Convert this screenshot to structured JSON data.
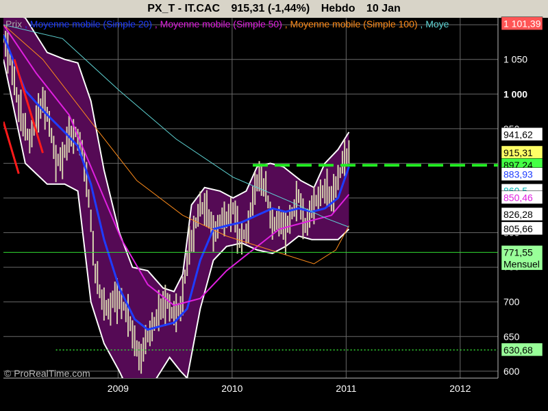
{
  "header": {
    "symbol": "PX_T - IT.CAC",
    "last": "915,31 (-1,44%)",
    "period": "Hebdo",
    "date": "10 Jan"
  },
  "legend": {
    "price": "Prix",
    "ma20": "Moyenne mobile (Simple 20)",
    "ma50": "Moyenne mobile (Simple 50)",
    "ma100": "Moyenne mobile (Simple 100)",
    "ma200": "Moye"
  },
  "watermark": "© ProRealTime.com",
  "colors": {
    "background": "#000000",
    "header": "#d8d4c8",
    "bollinger_fill": "#550a55",
    "bollinger_edge": "#ffffff",
    "candle": "#d8d4b0",
    "ma20": "#1e3cff",
    "ma50": "#e020e0",
    "ma100": "#ff8c1a",
    "ma200": "#5fd6d6",
    "resistance": "#22ee22",
    "support_line": "#33dd33",
    "trend": "#ff1a1a"
  },
  "chart_data": {
    "type": "line",
    "x_axis": {
      "ticks": [
        "2009",
        "2010",
        "2011",
        "2012"
      ]
    },
    "y_axis": {
      "range": [
        590,
        1110
      ],
      "ticks": [
        600,
        650,
        700,
        750,
        800,
        850,
        900,
        950,
        1000,
        1050,
        1100
      ],
      "tick_labels": [
        "600",
        "650",
        "700",
        "750",
        "800",
        "850",
        "900",
        "950",
        "1 000",
        "1 050",
        "1 100"
      ],
      "bold_ticks": [
        1000
      ]
    },
    "grid": true,
    "price_series": [
      [
        "2007-12-31",
        1080
      ],
      [
        "2008-01-21",
        1050
      ],
      [
        "2008-02-11",
        1000
      ],
      [
        "2008-03-03",
        955
      ],
      [
        "2008-03-24",
        935
      ],
      [
        "2008-04-14",
        960
      ],
      [
        "2008-05-05",
        990
      ],
      [
        "2008-05-26",
        960
      ],
      [
        "2008-06-16",
        900
      ],
      [
        "2008-07-07",
        910
      ],
      [
        "2008-07-28",
        935
      ],
      [
        "2008-08-18",
        945
      ],
      [
        "2008-09-08",
        920
      ],
      [
        "2008-09-29",
        850
      ],
      [
        "2008-10-20",
        745
      ],
      [
        "2008-11-10",
        700
      ],
      [
        "2008-12-01",
        690
      ],
      [
        "2008-12-22",
        705
      ],
      [
        "2009-01-12",
        700
      ],
      [
        "2009-02-02",
        680
      ],
      [
        "2009-02-23",
        640
      ],
      [
        "2009-03-16",
        620
      ],
      [
        "2009-04-06",
        650
      ],
      [
        "2009-04-27",
        670
      ],
      [
        "2009-05-18",
        690
      ],
      [
        "2009-06-08",
        700
      ],
      [
        "2009-06-29",
        680
      ],
      [
        "2009-07-20",
        690
      ],
      [
        "2009-08-10",
        760
      ],
      [
        "2009-08-31",
        800
      ],
      [
        "2009-09-21",
        840
      ],
      [
        "2009-10-12",
        830
      ],
      [
        "2009-11-02",
        800
      ],
      [
        "2009-11-23",
        815
      ],
      [
        "2009-12-14",
        820
      ],
      [
        "2010-01-04",
        835
      ],
      [
        "2010-01-25",
        790
      ],
      [
        "2010-02-15",
        800
      ],
      [
        "2010-03-08",
        845
      ],
      [
        "2010-03-29",
        885
      ],
      [
        "2010-04-19",
        860
      ],
      [
        "2010-05-10",
        810
      ],
      [
        "2010-05-31",
        820
      ],
      [
        "2010-06-21",
        800
      ],
      [
        "2010-07-12",
        830
      ],
      [
        "2010-08-02",
        850
      ],
      [
        "2010-08-23",
        810
      ],
      [
        "2010-09-13",
        835
      ],
      [
        "2010-10-04",
        850
      ],
      [
        "2010-10-25",
        865
      ],
      [
        "2010-11-15",
        845
      ],
      [
        "2010-12-06",
        880
      ],
      [
        "2010-12-27",
        905
      ],
      [
        "2011-01-10",
        915
      ]
    ],
    "moving_averages": [
      {
        "name": "Moyenne mobile (Simple 20)",
        "color": "#1e3cff",
        "points": [
          [
            "2007-12-31",
            1085
          ],
          [
            "2008-03-10",
            1005
          ],
          [
            "2008-05-19",
            970
          ],
          [
            "2008-07-14",
            945
          ],
          [
            "2008-08-25",
            925
          ],
          [
            "2008-10-06",
            870
          ],
          [
            "2008-11-17",
            790
          ],
          [
            "2009-01-05",
            720
          ],
          [
            "2009-02-23",
            675
          ],
          [
            "2009-04-06",
            660
          ],
          [
            "2009-05-18",
            665
          ],
          [
            "2009-06-29",
            670
          ],
          [
            "2009-08-10",
            690
          ],
          [
            "2009-09-21",
            760
          ],
          [
            "2009-11-02",
            805
          ],
          [
            "2009-12-14",
            810
          ],
          [
            "2010-02-01",
            815
          ],
          [
            "2010-03-22",
            825
          ],
          [
            "2010-05-10",
            835
          ],
          [
            "2010-06-21",
            830
          ],
          [
            "2010-08-02",
            835
          ],
          [
            "2010-09-13",
            830
          ],
          [
            "2010-10-25",
            835
          ],
          [
            "2010-12-06",
            850
          ],
          [
            "2011-01-10",
            895
          ]
        ]
      },
      {
        "name": "Moyenne mobile (Simple 50)",
        "color": "#e020e0",
        "points": [
          [
            "2007-12-31",
            1100
          ],
          [
            "2008-04-14",
            1030
          ],
          [
            "2008-07-28",
            970
          ],
          [
            "2008-10-20",
            880
          ],
          [
            "2009-01-12",
            790
          ],
          [
            "2009-04-06",
            725
          ],
          [
            "2009-06-29",
            695
          ],
          [
            "2009-09-21",
            705
          ],
          [
            "2009-12-14",
            745
          ],
          [
            "2010-03-08",
            775
          ],
          [
            "2010-06-01",
            805
          ],
          [
            "2010-08-23",
            815
          ],
          [
            "2010-11-15",
            825
          ],
          [
            "2011-01-10",
            855
          ]
        ]
      },
      {
        "name": "Moyenne mobile (Simple 100)",
        "color": "#ff8c1a",
        "points": [
          [
            "2007-12-31",
            1100
          ],
          [
            "2008-05-05",
            1050
          ],
          [
            "2008-10-06",
            960
          ],
          [
            "2009-03-02",
            875
          ],
          [
            "2009-07-27",
            825
          ],
          [
            "2009-12-14",
            795
          ],
          [
            "2010-05-03",
            775
          ],
          [
            "2010-09-20",
            755
          ],
          [
            "2010-11-29",
            775
          ],
          [
            "2011-01-10",
            810
          ]
        ]
      },
      {
        "name": "Moye",
        "color": "#5fd6d6",
        "points": [
          [
            "2007-12-31",
            1100
          ],
          [
            "2008-07-07",
            1080
          ],
          [
            "2009-01-05",
            1005
          ],
          [
            "2009-07-06",
            935
          ],
          [
            "2010-01-04",
            880
          ],
          [
            "2010-07-05",
            845
          ],
          [
            "2010-11-01",
            820
          ],
          [
            "2011-01-10",
            808
          ]
        ]
      }
    ],
    "bollinger_bands": {
      "upper": [
        [
          "2007-12-31",
          1120
        ],
        [
          "2008-03-10",
          1110
        ],
        [
          "2008-05-19",
          1060
        ],
        [
          "2008-07-14",
          1050
        ],
        [
          "2008-08-25",
          1045
        ],
        [
          "2008-10-06",
          990
        ],
        [
          "2008-11-17",
          890
        ],
        [
          "2009-01-05",
          800
        ],
        [
          "2009-02-16",
          750
        ],
        [
          "2009-04-06",
          745
        ],
        [
          "2009-05-25",
          720
        ],
        [
          "2009-06-29",
          715
        ],
        [
          "2009-07-27",
          740
        ],
        [
          "2009-08-24",
          840
        ],
        [
          "2009-10-05",
          865
        ],
        [
          "2009-11-23",
          860
        ],
        [
          "2010-01-04",
          850
        ],
        [
          "2010-02-15",
          860
        ],
        [
          "2010-03-22",
          895
        ],
        [
          "2010-05-03",
          900
        ],
        [
          "2010-06-14",
          895
        ],
        [
          "2010-08-09",
          875
        ],
        [
          "2010-09-20",
          865
        ],
        [
          "2010-10-25",
          900
        ],
        [
          "2010-12-06",
          920
        ],
        [
          "2011-01-10",
          945
        ]
      ],
      "lower": [
        [
          "2007-12-31",
          1050
        ],
        [
          "2008-03-10",
          900
        ],
        [
          "2008-05-19",
          870
        ],
        [
          "2008-07-14",
          870
        ],
        [
          "2008-08-25",
          860
        ],
        [
          "2008-10-06",
          700
        ],
        [
          "2008-11-17",
          640
        ],
        [
          "2009-01-05",
          600
        ],
        [
          "2009-02-16",
          560
        ],
        [
          "2009-04-06",
          570
        ],
        [
          "2009-05-18",
          600
        ],
        [
          "2009-06-15",
          620
        ],
        [
          "2009-07-20",
          600
        ],
        [
          "2009-08-10",
          590
        ],
        [
          "2009-09-21",
          690
        ],
        [
          "2009-11-02",
          760
        ],
        [
          "2009-12-14",
          780
        ],
        [
          "2010-02-01",
          785
        ],
        [
          "2010-03-22",
          775
        ],
        [
          "2010-05-10",
          770
        ],
        [
          "2010-06-21",
          780
        ],
        [
          "2010-08-02",
          795
        ],
        [
          "2010-09-13",
          790
        ],
        [
          "2010-10-25",
          790
        ],
        [
          "2010-12-06",
          790
        ],
        [
          "2011-01-10",
          805
        ]
      ]
    },
    "horizontal_levels": [
      {
        "value": 897.24,
        "style": "dashed",
        "color": "#22ee22",
        "start": "2010-03-08"
      },
      {
        "value": 771.55,
        "style": "solid",
        "color": "#33dd33",
        "start": "2007-12-31"
      },
      {
        "value": 630.68,
        "style": "dotted",
        "color": "#33dd33",
        "start": "2008-06-16"
      }
    ],
    "trend_lines": [
      {
        "color": "#ff1a1a",
        "points": [
          [
            "2007-12-31",
            960
          ],
          [
            "2008-02-18",
            885
          ]
        ]
      },
      {
        "color": "#ff1a1a",
        "points": [
          [
            "2008-02-04",
            1050
          ],
          [
            "2008-05-05",
            915
          ]
        ]
      }
    ],
    "price_labels": [
      {
        "text": "1 101,39",
        "value": 1101.39,
        "bg": "#ff5555",
        "fg": "#ffffff"
      },
      {
        "text": "941,62",
        "value": 941.62,
        "bg": "#ffffff",
        "fg": "#000000"
      },
      {
        "text": "915,31",
        "value": 915.31,
        "bg": "#ffff66",
        "fg": "#000000"
      },
      {
        "text": "897,24",
        "value": 897.24,
        "bg": "#44ff44",
        "fg": "#000000"
      },
      {
        "text": "883,93",
        "value": 883.93,
        "bg": "#ffffff",
        "fg": "#1e3cff"
      },
      {
        "text": "860,5",
        "value": 860.5,
        "bg": "#ffffff",
        "fg": "#00b7b7"
      },
      {
        "text": "850,46",
        "value": 850.46,
        "bg": "#ffffff",
        "fg": "#e020e0"
      },
      {
        "text": "826,28",
        "value": 826.28,
        "bg": "#ffffff",
        "fg": "#000000"
      },
      {
        "text": "805,66",
        "value": 805.66,
        "bg": "#ffffff",
        "fg": "#000000"
      },
      {
        "text": "771,55",
        "value": 771.55,
        "bg": "#99ff99",
        "fg": "#000000",
        "sub": "Mensuel"
      },
      {
        "text": "630,68",
        "value": 630.68,
        "bg": "#99ff99",
        "fg": "#000000"
      }
    ]
  }
}
